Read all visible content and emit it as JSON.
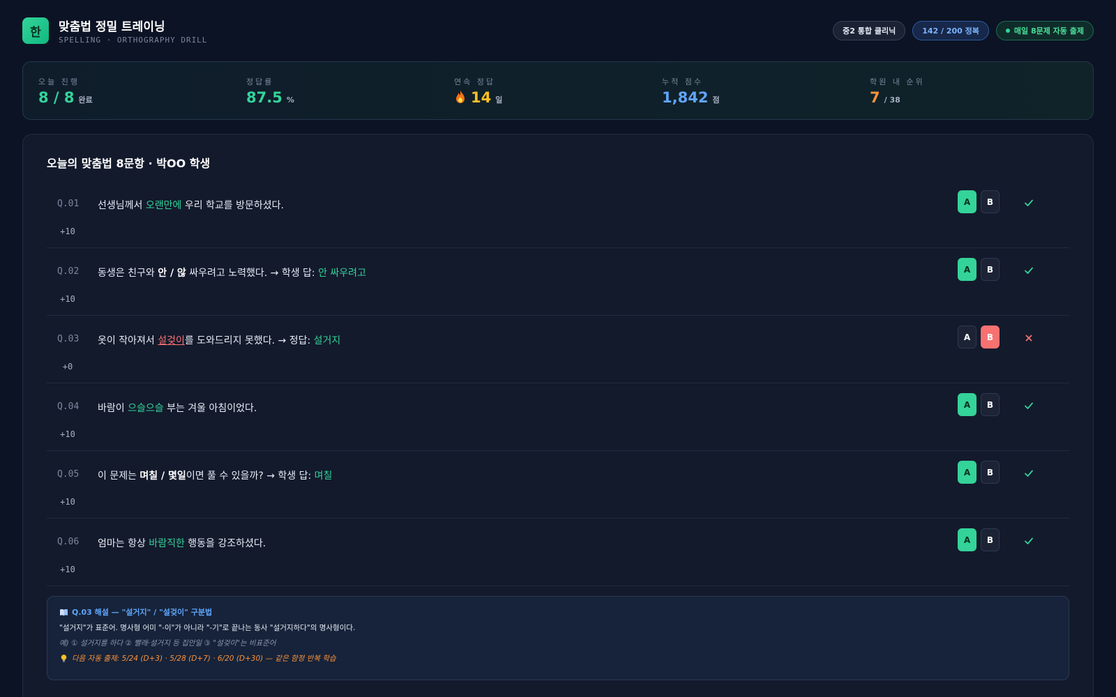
{
  "header": {
    "logo_char": "한",
    "title": "맞춤법 정밀 트레이닝",
    "subtitle": "SPELLING · ORTHOGRAPHY DRILL",
    "pills": {
      "clinic": "중2 통합 클리닉",
      "score": "142 / 200 정복",
      "auto": "매일 8문제 자동 출제"
    }
  },
  "stats": {
    "today": {
      "label": "오늘 진행",
      "value": "8 / 8",
      "unit": "완료"
    },
    "accuracy": {
      "label": "정답률",
      "value": "87.5",
      "unit": "%"
    },
    "streak": {
      "label": "연속 정답",
      "value": "14",
      "unit": "일"
    },
    "total": {
      "label": "누적 점수",
      "value": "1,842",
      "unit": "점"
    },
    "rank": {
      "label": "학원 내 순위",
      "value": "7",
      "unit": "/ 38"
    }
  },
  "quiz": {
    "title": "오늘의 맞춤법 8문항 · 박OO 학생",
    "option_a": "A",
    "option_b": "B",
    "questions": [
      {
        "num": "Q.01",
        "points": "+10",
        "selected": "A",
        "result": "correct",
        "parts": {
          "a": "선생님께서 ",
          "b": "오랜만에",
          "c": " 우리 학교를 방문하셨다."
        }
      },
      {
        "num": "Q.02",
        "points": "+10",
        "selected": "A",
        "result": "correct",
        "parts": {
          "a": "동생은 친구와 ",
          "b": "안 / 않",
          "c": " 싸우려고 노력했다. → 학생 답: ",
          "d": "안 싸우려고"
        }
      },
      {
        "num": "Q.03",
        "points": "+0",
        "selected": "B",
        "result": "wrong",
        "parts": {
          "a": "옷이 작아져서 ",
          "b": "설겆이",
          "c": "를 도와드리지 못했다. → 정답: ",
          "d": "설거지"
        }
      },
      {
        "num": "Q.04",
        "points": "+10",
        "selected": "A",
        "result": "correct",
        "parts": {
          "a": "바람이 ",
          "b": "으슬으슬",
          "c": " 부는 겨울 아침이었다."
        }
      },
      {
        "num": "Q.05",
        "points": "+10",
        "selected": "A",
        "result": "correct",
        "parts": {
          "a": "이 문제는 ",
          "b": "며칠 / 몇일",
          "c": "이면 풀 수 있을까? → 학생 답: ",
          "d": "며칠"
        }
      },
      {
        "num": "Q.06",
        "points": "+10",
        "selected": "A",
        "result": "correct",
        "parts": {
          "a": "엄마는 항상 ",
          "b": "바람직한",
          "c": " 행동을 강조하셨다."
        }
      }
    ]
  },
  "explanation": {
    "title": "Q.03 해설 — \"설거지\" / \"설겆이\" 구분법",
    "body": "\"설거지\"가 표준어. 명사형 어미 \"-이\"가 아니라 \"-기\"로 끝나는 동사 \"설거지하다\"의 명사형이다.",
    "example": "예) ① 설거지를 하다 ② 빨래·설거지 등 집안일 ③ \"설겆이\"는 비표준어",
    "next": "다음 자동 출제: 5/24 (D+3) · 5/28 (D+7) · 6/20 (D+30) — 같은 함정 반복 학습"
  },
  "colors": {
    "accent_green": "#34d399",
    "accent_red": "#f87171",
    "accent_blue": "#60a5fa",
    "accent_gold": "#fbbf24",
    "accent_orange": "#fb923c"
  },
  "icons": {
    "streak": "fire-icon",
    "explanation": "book-icon",
    "next": "lightbulb-icon",
    "correct": "check-icon",
    "wrong": "x-icon"
  }
}
